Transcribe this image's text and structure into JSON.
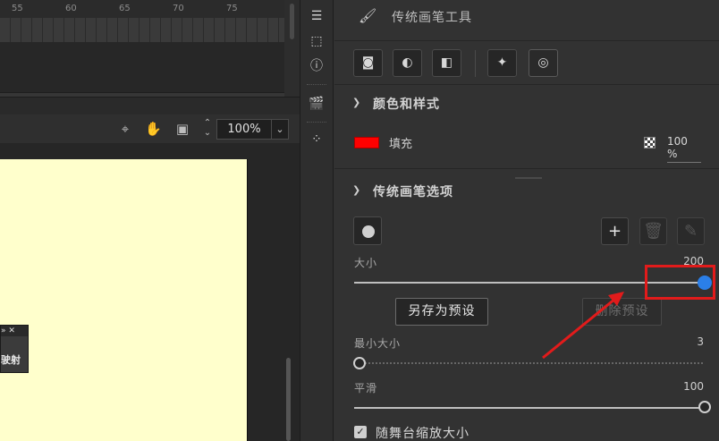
{
  "timeline": {
    "ruler_labels": [
      "55",
      "60",
      "65",
      "70",
      "75"
    ]
  },
  "stage_toolbar": {
    "zoom_value": "100%"
  },
  "float_panel": {
    "head": "» ✕",
    "text": "驶射"
  },
  "panel": {
    "tool_title": "传统画笔工具",
    "section_color": {
      "title": "颜色和样式",
      "fill_label": "填充",
      "fill_color": "#ff0000",
      "alpha": "100 %"
    },
    "section_brush": {
      "title": "传统画笔选项",
      "size_label": "大小",
      "size_value": "200",
      "size_level": 1.0,
      "save_preset": "另存为预设",
      "delete_preset": "删除预设",
      "min_size_label": "最小大小",
      "min_size_value": "3",
      "min_size_level": 0.015,
      "smooth_label": "平滑",
      "smooth_value": "100",
      "smooth_level": 1.0,
      "scale_with_stage_label": "随舞台缩放大小",
      "scale_with_stage_checked": true
    }
  },
  "annotation": {
    "color": "#e21b1b"
  }
}
